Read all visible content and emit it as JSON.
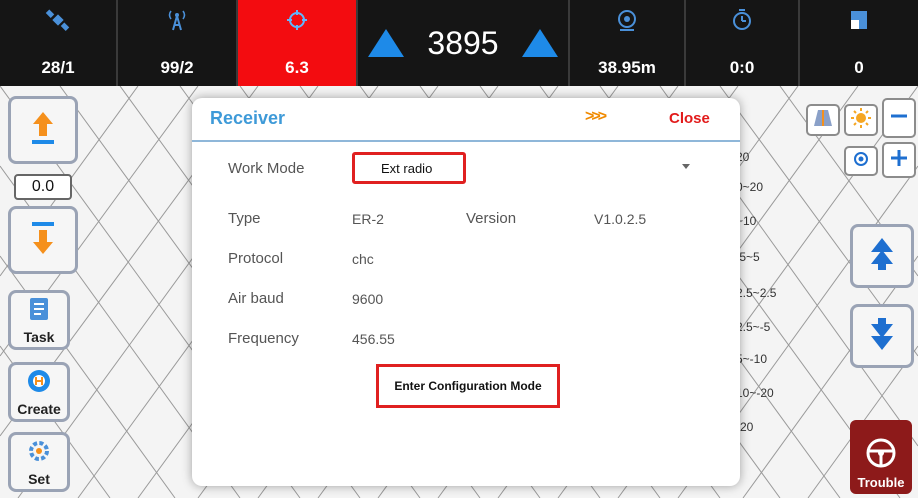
{
  "statusbar": {
    "satellites": "28/1",
    "signal": "99/2",
    "precision": "6.3",
    "line_number": "3895",
    "distance": "38.95m",
    "time": "0:0",
    "area": "0"
  },
  "left_toolbar": {
    "offset_value": "0.0",
    "task_label": "Task",
    "create_label": "Create",
    "set_label": "Set"
  },
  "right_panel": {
    "trouble_label": "Trouble",
    "scale_labels": [
      "20",
      "0~20",
      "~10",
      ".5~5",
      "2.5~2.5",
      "2.5~-5",
      "5~-10",
      "10~-20",
      "-20"
    ]
  },
  "dialog": {
    "title": "Receiver",
    "arrows": ">>>",
    "close_label": "Close",
    "work_mode_label": "Work Mode",
    "work_mode_value": "Ext radio",
    "type_label": "Type",
    "type_value": "ER-2",
    "version_label": "Version",
    "version_value": "V1.0.2.5",
    "protocol_label": "Protocol",
    "protocol_value": "chc",
    "air_baud_label": "Air baud",
    "air_baud_value": "9600",
    "frequency_label": "Frequency",
    "frequency_value": "456.55",
    "config_button_label": "Enter Configuration Mode"
  },
  "colors": {
    "accent_blue": "#1e8ae8",
    "alert_red": "#f30c10",
    "highlight_red": "#e02020",
    "trouble_red": "#8d1a1a",
    "title_blue": "#3e9ad8",
    "arrow_orange": "#f08a00"
  }
}
